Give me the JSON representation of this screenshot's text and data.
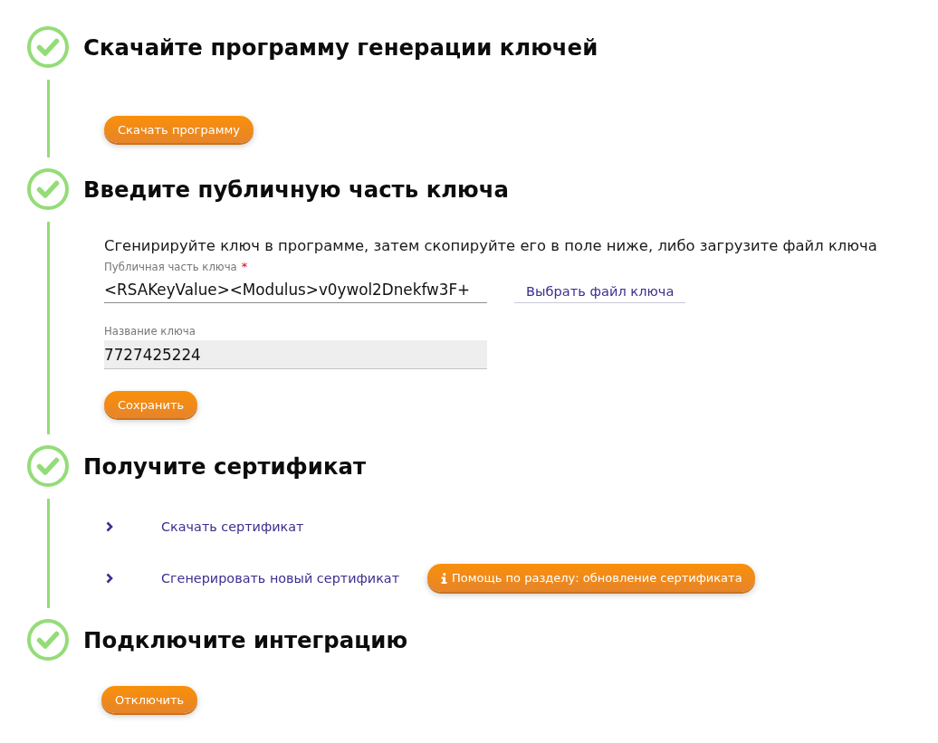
{
  "steps": [
    {
      "title": "Скачайте программу генерации ключей",
      "completed": true,
      "blocks": [
        {
          "kind": "button",
          "label": "Скачать программу"
        }
      ]
    },
    {
      "title": "Введите публичную часть ключа",
      "completed": true,
      "blocks": [
        {
          "kind": "text",
          "text": "Сгенирируйте ключ в программе, затем скопируйте его в поле ниже, либо загрузите файл ключа"
        },
        {
          "kind": "field",
          "label": "Публичная часть ключа",
          "required_mark": "*",
          "value": "<RSAKeyValue><Modulus>v0ywol2Dnekfw3F+",
          "readonly": false,
          "link": "Выбрать файл ключа"
        },
        {
          "kind": "field",
          "label": "Название ключа",
          "value": "7727425224",
          "readonly": true
        },
        {
          "kind": "button",
          "label": "Сохранить"
        }
      ]
    },
    {
      "title": "Получите сертификат",
      "completed": true,
      "blocks": [
        {
          "kind": "link",
          "label": "Скачать сертификат"
        },
        {
          "kind": "link",
          "label": "Сгенерировать новый сертификат",
          "help": "Помощь по разделу: обновление сертификата"
        }
      ]
    },
    {
      "title": "Подключите интеграцию",
      "completed": true,
      "blocks": [
        {
          "kind": "button",
          "label": "Отключить"
        }
      ]
    }
  ]
}
